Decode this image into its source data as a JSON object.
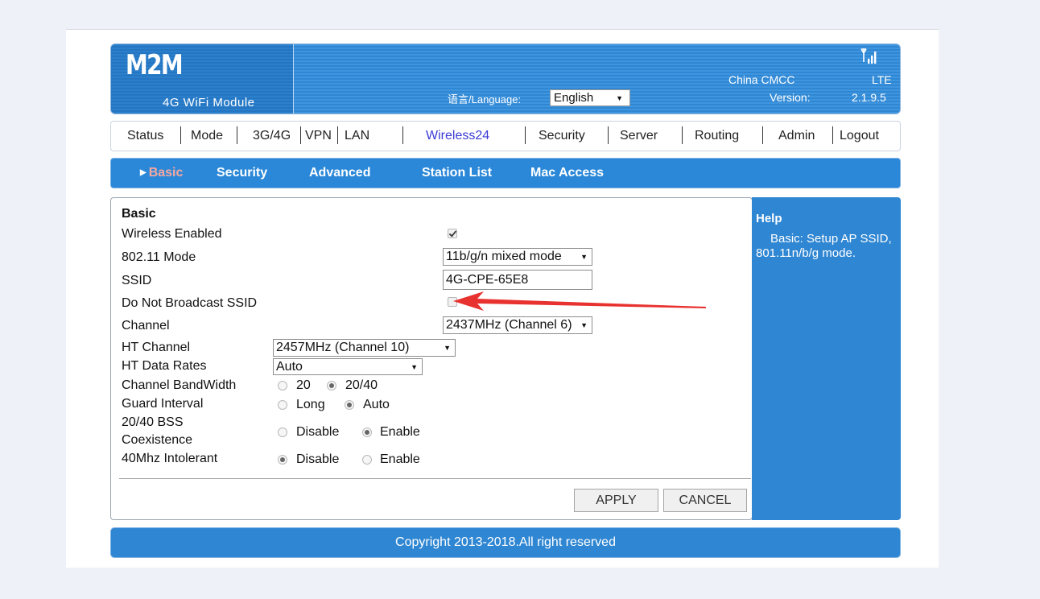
{
  "header": {
    "logo": "M2M",
    "logo_sub": "4G WiFi Module",
    "language_label": "语言/Language:",
    "language_value": "English",
    "carrier": "China CMCC",
    "network": "LTE",
    "version_label": "Version:",
    "version": "2.1.9.5"
  },
  "nav": {
    "items": [
      "Status",
      "Mode",
      "3G/4G",
      "VPN",
      "LAN",
      "Wireless24",
      "Security",
      "Server",
      "Routing",
      "Admin",
      "Logout"
    ],
    "active": "Wireless24"
  },
  "subnav": {
    "items": [
      "Basic",
      "Security",
      "Advanced",
      "Station List",
      "Mac Access"
    ],
    "active": "Basic"
  },
  "form": {
    "section_title": "Basic",
    "wireless_enabled_label": "Wireless Enabled",
    "wireless_enabled": true,
    "mode_label": "802.11 Mode",
    "mode_value": "11b/g/n mixed mode",
    "ssid_label": "SSID",
    "ssid_value": "4G-CPE-65E8",
    "hide_ssid_label": "Do Not Broadcast SSID",
    "hide_ssid": false,
    "channel_label": "Channel",
    "channel_value": "2437MHz (Channel 6)",
    "ht_channel_label": "HT Channel",
    "ht_channel_value": "2457MHz (Channel 10)",
    "ht_rates_label": "HT Data Rates",
    "ht_rates_value": "Auto",
    "bandwidth_label": "Channel BandWidth",
    "bandwidth_options": [
      "20",
      "20/40"
    ],
    "bandwidth_selected": "20/40",
    "guard_label": "Guard Interval",
    "guard_options": [
      "Long",
      "Auto"
    ],
    "guard_selected": "Auto",
    "bss_label_1": "20/40 BSS",
    "bss_label_2": "Coexistence",
    "bss_options": [
      "Disable",
      "Enable"
    ],
    "bss_selected": "Enable",
    "intolerant_label": "40Mhz Intolerant",
    "intolerant_options": [
      "Disable",
      "Enable"
    ],
    "intolerant_selected": "Disable",
    "apply_label": "APPLY",
    "cancel_label": "CANCEL"
  },
  "help": {
    "title": "Help",
    "text": "Basic: Setup AP SSID, 801.11n/b/g mode."
  },
  "footer": {
    "text": "Copyright 2013-2018.All right reserved"
  },
  "colors": {
    "header_blue": "#3f95de",
    "panel_blue": "#2f86d2",
    "active_nav": "#3b3bd6",
    "active_sub": "#f7a8a0",
    "annotation_arrow": "#e8322f"
  }
}
